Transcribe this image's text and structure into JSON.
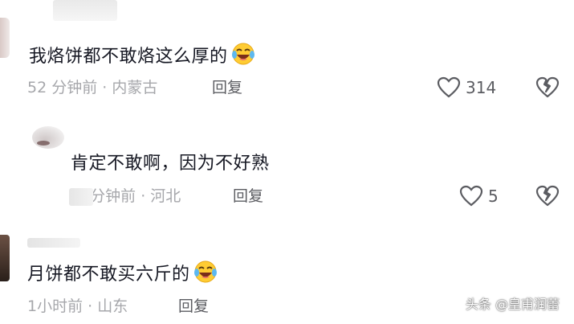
{
  "comments": [
    {
      "text": "我烙饼都不敢烙这么厚的",
      "emoji": "laughing-crying-emoji",
      "time": "52 分钟前 · 内蒙古",
      "reply_label": "回复",
      "likes": "314"
    },
    {
      "text": "肯定不敢啊，因为不好熟",
      "time": "21分钟前 · 河北",
      "reply_label": "回复",
      "likes": "5"
    },
    {
      "text": "月饼都不敢买六斤的",
      "emoji": "laughing-crying-emoji",
      "time": "1小时前 · 山东",
      "reply_label": "回复"
    }
  ],
  "watermark": "头条 @皇甫润蕾",
  "colors": {
    "text": "#161823",
    "meta": "#a6a7ab",
    "icon": "#5b5c61",
    "emoji_face": "#ffcc33"
  }
}
